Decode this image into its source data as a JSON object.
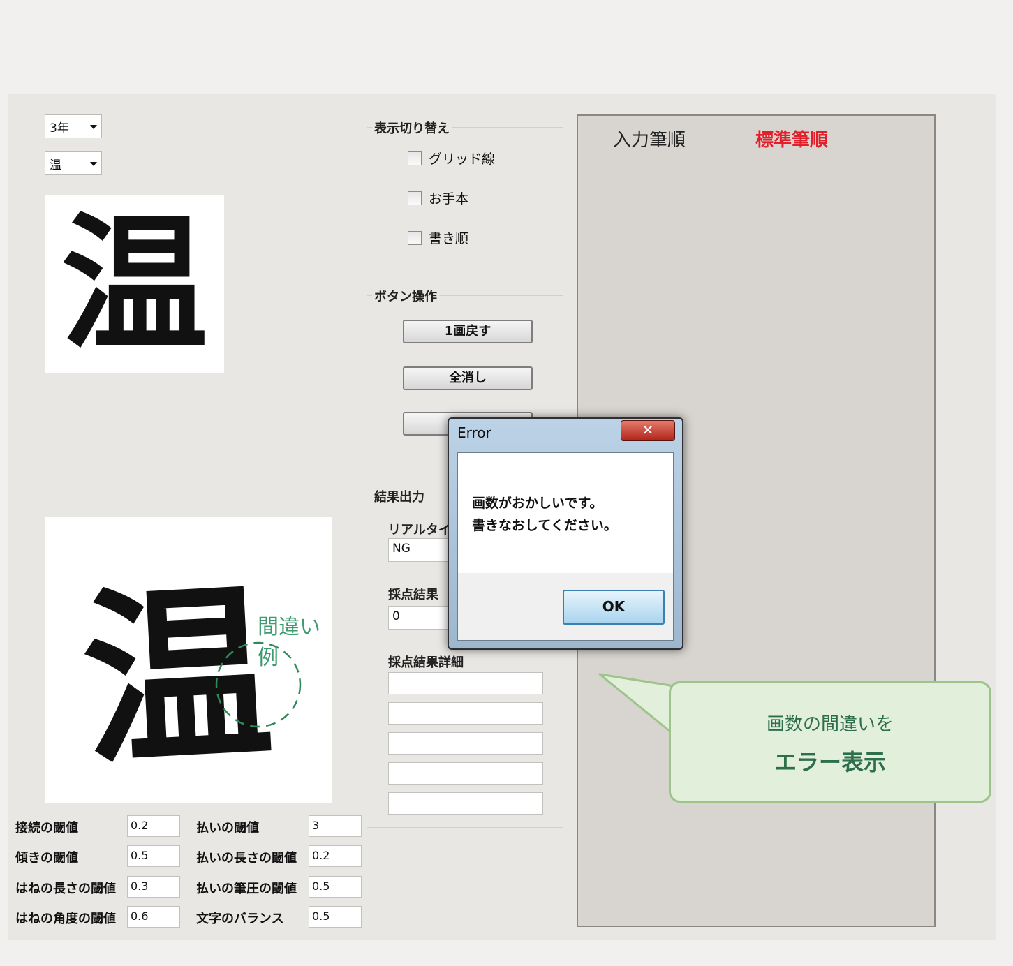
{
  "selectors": {
    "grade": "3年",
    "kanji": "温"
  },
  "model_char": "温",
  "written_char": "温",
  "error_example_label": "間違い例",
  "display_group": {
    "title": "表示切り替え",
    "options": [
      "グリッド線",
      "お手本",
      "書き順"
    ]
  },
  "button_group": {
    "title": "ボタン操作",
    "buttons": [
      "1画戻す",
      "全消し"
    ]
  },
  "result_group": {
    "title": "結果出力",
    "realtime_label": "リアルタイム",
    "realtime_value": "NG",
    "score_label": "採点結果",
    "score_value": "0",
    "detail_label": "採点結果詳細"
  },
  "params": [
    {
      "label": "接続の閾値",
      "value": "0.2"
    },
    {
      "label": "傾きの閾値",
      "value": "0.5"
    },
    {
      "label": "はねの長さの閾値",
      "value": "0.3"
    },
    {
      "label": "はねの角度の閾値",
      "value": "0.6"
    },
    {
      "label": "払いの閾値",
      "value": "3"
    },
    {
      "label": "払いの長さの閾値",
      "value": "0.2"
    },
    {
      "label": "払いの筆圧の閾値",
      "value": "0.5"
    },
    {
      "label": "文字のバランス",
      "value": "0.5"
    }
  ],
  "order_panel": {
    "input_order": "入力筆順",
    "standard_order": "標準筆順",
    "standard_color": "#e0202a"
  },
  "dialog": {
    "title": "Error",
    "close_symbol": "✕",
    "message_line1": "画数がおかしいです。",
    "message_line2": "書きなおしてください。",
    "ok": "OK"
  },
  "callout": {
    "line1": "画数の間違いを",
    "line2": "エラー表示"
  }
}
